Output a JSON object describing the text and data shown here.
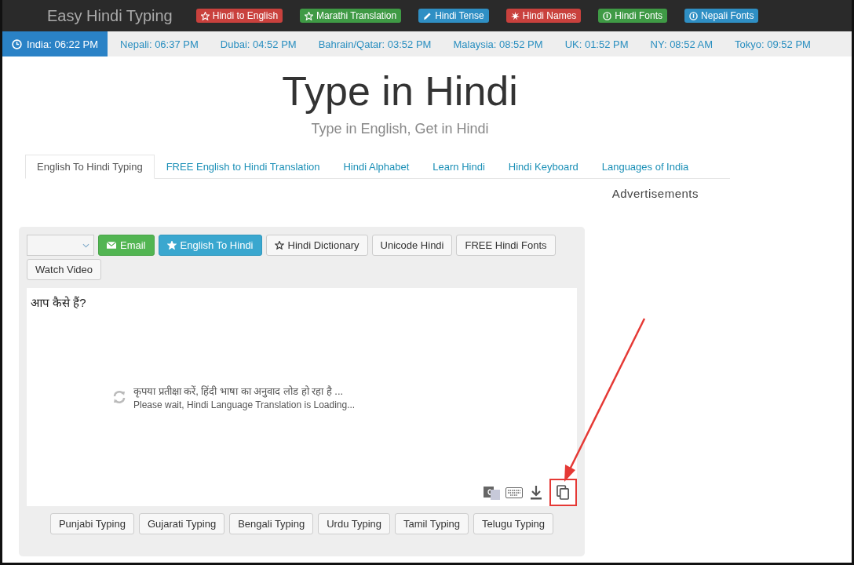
{
  "nav": {
    "brand": "Easy Hindi Typing",
    "links": [
      {
        "label": "Hindi to English",
        "kind": "star",
        "color": "#c9413d"
      },
      {
        "label": "Marathi Translation",
        "kind": "star",
        "color": "#3f9a45"
      },
      {
        "label": "Hindi Tense",
        "kind": "pencil",
        "color": "#2f8fc4"
      },
      {
        "label": "Hindi Names",
        "kind": "burst",
        "color": "#c9413d"
      },
      {
        "label": "Hindi Fonts",
        "kind": "info",
        "color": "#3f9a45"
      },
      {
        "label": "Nepali Fonts",
        "kind": "info",
        "color": "#2f8fc4"
      }
    ]
  },
  "clocks": [
    {
      "label": "India: 06:22 PM",
      "selected": true
    },
    {
      "label": "Nepali: 06:37 PM",
      "selected": false
    },
    {
      "label": "Dubai: 04:52 PM",
      "selected": false
    },
    {
      "label": "Bahrain/Qatar: 03:52 PM",
      "selected": false
    },
    {
      "label": "Malaysia: 08:52 PM",
      "selected": false
    },
    {
      "label": "UK: 01:52 PM",
      "selected": false
    },
    {
      "label": "NY: 08:52 AM",
      "selected": false
    },
    {
      "label": "Tokyo: 09:52 PM",
      "selected": false
    }
  ],
  "heading": "Type in Hindi",
  "subheading": "Type in English, Get in Hindi",
  "tabs": [
    {
      "label": "English To Hindi Typing",
      "selected": true
    },
    {
      "label": "FREE English to Hindi Translation",
      "selected": false
    },
    {
      "label": "Hindi Alphabet",
      "selected": false
    },
    {
      "label": "Learn Hindi",
      "selected": false
    },
    {
      "label": "Hindi Keyboard",
      "selected": false
    },
    {
      "label": "Languages of India",
      "selected": false
    }
  ],
  "ads_label": "Advertisements",
  "toolbar": {
    "buttons": [
      {
        "label": "Email",
        "kind": "email"
      },
      {
        "label": "English To Hindi",
        "kind": "primary"
      },
      {
        "label": "Hindi Dictionary",
        "kind": "star"
      },
      {
        "label": "Unicode Hindi",
        "kind": "plain"
      },
      {
        "label": "FREE Hindi Fonts",
        "kind": "plain"
      },
      {
        "label": "Watch Video",
        "kind": "plain"
      }
    ]
  },
  "editor": {
    "value": "आप कैसे हैं?",
    "loading_hindi": "कृपया प्रतीक्षा करें, हिंदी भाषा का अनुवाद लोड हो रहा है ...",
    "loading_english": "Please wait, Hindi Language Translation is Loading..."
  },
  "bottom_buttons": [
    "Punjabi Typing",
    "Gujarati Typing",
    "Bengali Typing",
    "Urdu Typing",
    "Tamil Typing",
    "Telugu Typing"
  ]
}
